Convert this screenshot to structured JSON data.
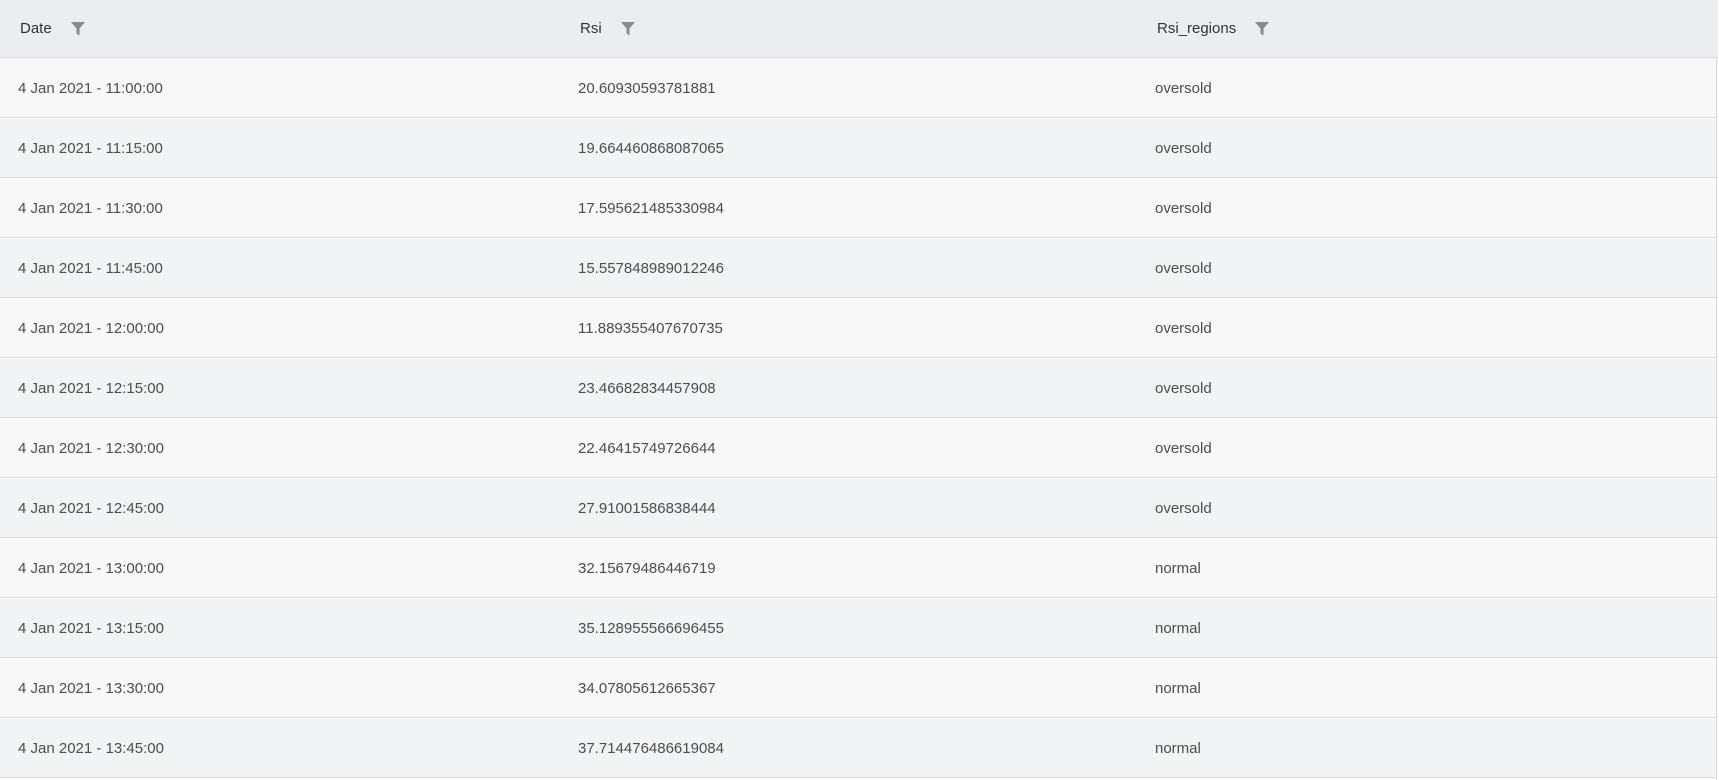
{
  "table": {
    "columns": [
      {
        "label": "Date",
        "filter_icon": "filter-icon"
      },
      {
        "label": "Rsi",
        "filter_icon": "filter-icon"
      },
      {
        "label": "Rsi_regions",
        "filter_icon": "filter-icon"
      }
    ],
    "rows": [
      {
        "date": "4 Jan 2021 - 11:00:00",
        "rsi": "20.60930593781881",
        "region": "oversold"
      },
      {
        "date": "4 Jan 2021 - 11:15:00",
        "rsi": "19.664460868087065",
        "region": "oversold"
      },
      {
        "date": "4 Jan 2021 - 11:30:00",
        "rsi": "17.595621485330984",
        "region": "oversold"
      },
      {
        "date": "4 Jan 2021 - 11:45:00",
        "rsi": "15.557848989012246",
        "region": "oversold"
      },
      {
        "date": "4 Jan 2021 - 12:00:00",
        "rsi": "11.889355407670735",
        "region": "oversold"
      },
      {
        "date": "4 Jan 2021 - 12:15:00",
        "rsi": "23.46682834457908",
        "region": "oversold"
      },
      {
        "date": "4 Jan 2021 - 12:30:00",
        "rsi": "22.46415749726644",
        "region": "oversold"
      },
      {
        "date": "4 Jan 2021 - 12:45:00",
        "rsi": "27.91001586838444",
        "region": "oversold"
      },
      {
        "date": "4 Jan 2021 - 13:00:00",
        "rsi": "32.15679486446719",
        "region": "normal"
      },
      {
        "date": "4 Jan 2021 - 13:15:00",
        "rsi": "35.128955566696455",
        "region": "normal"
      },
      {
        "date": "4 Jan 2021 - 13:30:00",
        "rsi": "34.07805612665367",
        "region": "normal"
      },
      {
        "date": "4 Jan 2021 - 13:45:00",
        "rsi": "37.714476486619084",
        "region": "normal"
      }
    ]
  },
  "colors": {
    "header_bg": "#ecedf1",
    "row_odd_bg": "#f8f8f8",
    "row_even_bg": "#f2f3f5",
    "icon": "#8a8a8a"
  }
}
